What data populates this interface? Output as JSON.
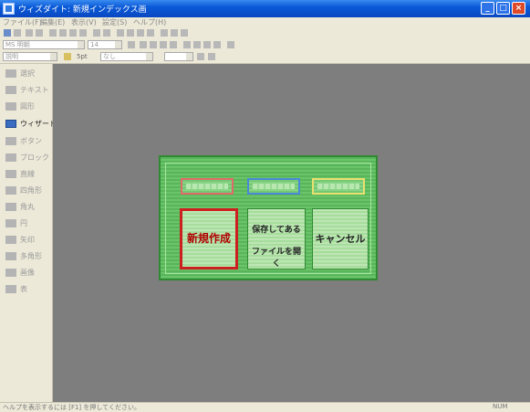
{
  "window": {
    "title": "ウィズダイト: 新規インデックス画",
    "min_label": "_",
    "max_label": "□",
    "close_label": "×"
  },
  "menu": [
    "ファイル(F)",
    "編集(E)",
    "表示(V)",
    "設定(S)",
    "ヘルプ(H)"
  ],
  "toolbar": {
    "font_name": "MS 明朝",
    "font_size": "14",
    "style_combo": "説明",
    "line_label": "5pt",
    "color_combo": "なし"
  },
  "palette": [
    {
      "label": "選択",
      "active": false
    },
    {
      "label": "テキスト",
      "active": false
    },
    {
      "label": "図形",
      "active": false
    },
    {
      "label": "ウィザード",
      "active": true
    },
    {
      "label": "ボタン",
      "active": false
    },
    {
      "label": "ブロック",
      "active": false
    },
    {
      "label": "直線",
      "active": false
    },
    {
      "label": "四角形",
      "active": false
    },
    {
      "label": "角丸",
      "active": false
    },
    {
      "label": "円",
      "active": false
    },
    {
      "label": "矢印",
      "active": false
    },
    {
      "label": "多角形",
      "active": false
    },
    {
      "label": "画像",
      "active": false
    },
    {
      "label": "表",
      "active": false
    }
  ],
  "design": {
    "new_button": "新規作成",
    "open_line1": "保存してある",
    "open_line2": "ファイルを開く",
    "cancel_button": "キャンセル",
    "colors": {
      "background": "#5cb85c",
      "new_border": "#cc2020",
      "slot1_border": "#e06a6a",
      "slot2_border": "#4a88d8",
      "slot3_border": "#e8e070"
    }
  },
  "status": {
    "message": "ヘルプを表示するには [F1] を押してください。",
    "mode": "NUM"
  }
}
